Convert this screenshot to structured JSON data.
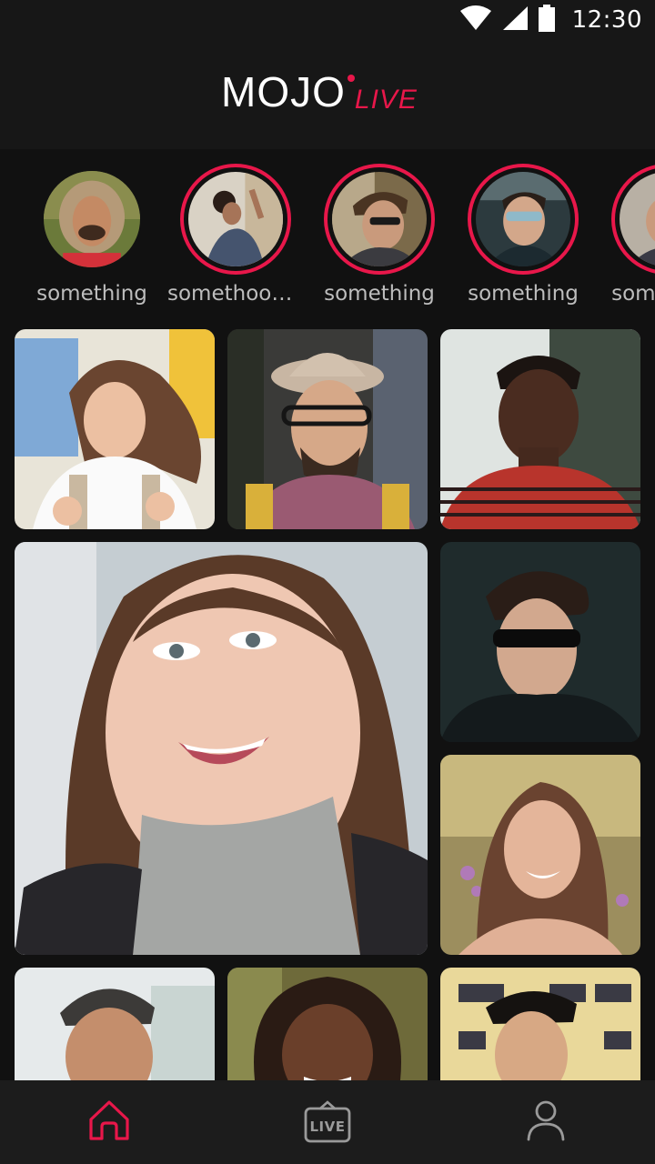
{
  "status_bar": {
    "time": "12:30",
    "icons": [
      "wifi-icon",
      "signal-icon",
      "battery-icon"
    ]
  },
  "header": {
    "logo_main": "MOJO",
    "logo_sub": "LIVE"
  },
  "colors": {
    "accent": "#e8174a",
    "background": "#111111",
    "bar": "#171717",
    "nav_inactive": "#9a9a9a"
  },
  "stories": [
    {
      "label": "something",
      "active": false
    },
    {
      "label": "somethooooo",
      "active": true
    },
    {
      "label": "something",
      "active": true
    },
    {
      "label": "something",
      "active": true
    },
    {
      "label": "something",
      "active": true
    }
  ],
  "feed": [
    {
      "kind": "photo",
      "subject": "woman with flowing hair"
    },
    {
      "kind": "photo",
      "subject": "man with hat and glasses"
    },
    {
      "kind": "photo",
      "subject": "man in striped shirt"
    },
    {
      "kind": "photo",
      "subject": "woman smiling in turtleneck"
    },
    {
      "kind": "photo",
      "subject": "man with sunglasses"
    },
    {
      "kind": "photo",
      "subject": "woman smiling outdoors"
    },
    {
      "kind": "photo",
      "subject": "man close-up"
    },
    {
      "kind": "photo",
      "subject": "woman smiling"
    },
    {
      "kind": "photo",
      "subject": "man in front of building"
    }
  ],
  "bottom_nav": {
    "items": [
      {
        "name": "home",
        "icon": "home-icon",
        "active": true
      },
      {
        "name": "live",
        "icon": "live-tv-icon",
        "label": "LIVE",
        "active": false
      },
      {
        "name": "profile",
        "icon": "profile-icon",
        "active": false
      }
    ]
  }
}
